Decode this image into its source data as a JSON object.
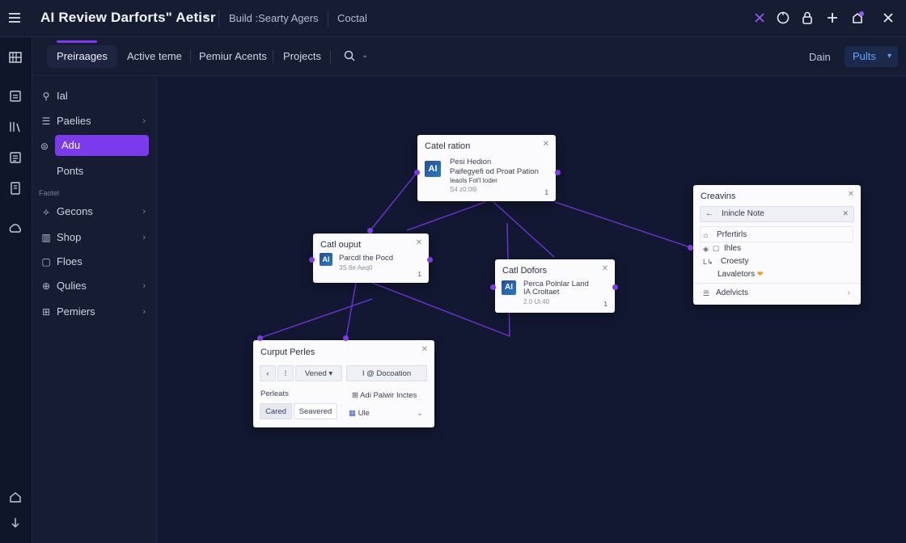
{
  "header": {
    "app_title": "AI Review Darforts\" Aetisr",
    "links": [
      "Build :Searty Agers",
      "Coctal"
    ]
  },
  "subnav": {
    "tabs": [
      "Preiraages",
      "Active teme",
      "Pemiur Acents",
      "Projects"
    ],
    "plain_button": "Dain",
    "primary_button": "Pults"
  },
  "sidebar": {
    "items": [
      {
        "label": "Ial",
        "icon": "person-icon",
        "chevron": false
      },
      {
        "label": "Paelies",
        "icon": "list-icon",
        "chevron": true
      },
      {
        "label": "Adu",
        "icon": "chat-icon",
        "chevron": false,
        "active": true
      },
      {
        "label": "Ponts",
        "icon": "",
        "chevron": false
      }
    ],
    "section_label": "Faotel",
    "section_items": [
      {
        "label": "Gecons",
        "icon": "wave-icon",
        "chevron": true
      },
      {
        "label": "Shop",
        "icon": "book-icon",
        "chevron": true
      },
      {
        "label": "Floes",
        "icon": "file-icon",
        "chevron": false
      },
      {
        "label": "Qulies",
        "icon": "globe-icon",
        "chevron": true
      },
      {
        "label": "Pemiers",
        "icon": "grid-icon",
        "chevron": true
      }
    ]
  },
  "nodes": {
    "main": {
      "title": "Catel ration",
      "thumb": "AI",
      "text": [
        "Pesi Hedion",
        "Paifegyefi od Proat Pation",
        "Ieaols Fot'l Ioder"
      ],
      "meta": "S4 z0:0l9",
      "num": "1"
    },
    "output": {
      "title": "Catl ouput",
      "thumb": "AI",
      "text": [
        "Parcdl the Pocd"
      ],
      "meta": "3S 8e Aeq0",
      "num": "1"
    },
    "dolors": {
      "title": "Catl Dofors",
      "thumb": "AI",
      "text": [
        "Perca Polnlar Land",
        "IA Croltaet"
      ],
      "meta": "2.0 Ul:40",
      "num": "1"
    },
    "creavins": {
      "title": "Creavins",
      "header_row": "Inincle Note",
      "rows": [
        "Prfertirls",
        "Ihles",
        "Croesty",
        "Lavaletors"
      ],
      "footer": "Adelvicts"
    },
    "parties": {
      "title": "Curput Perles",
      "toolbar": [
        "Vened",
        "@ Docoation"
      ],
      "left_label": "Perleats",
      "right_label": "Adi Palwir Inctes",
      "buttons": [
        "Cared",
        "Seavered"
      ],
      "select_value": "Ule"
    }
  }
}
